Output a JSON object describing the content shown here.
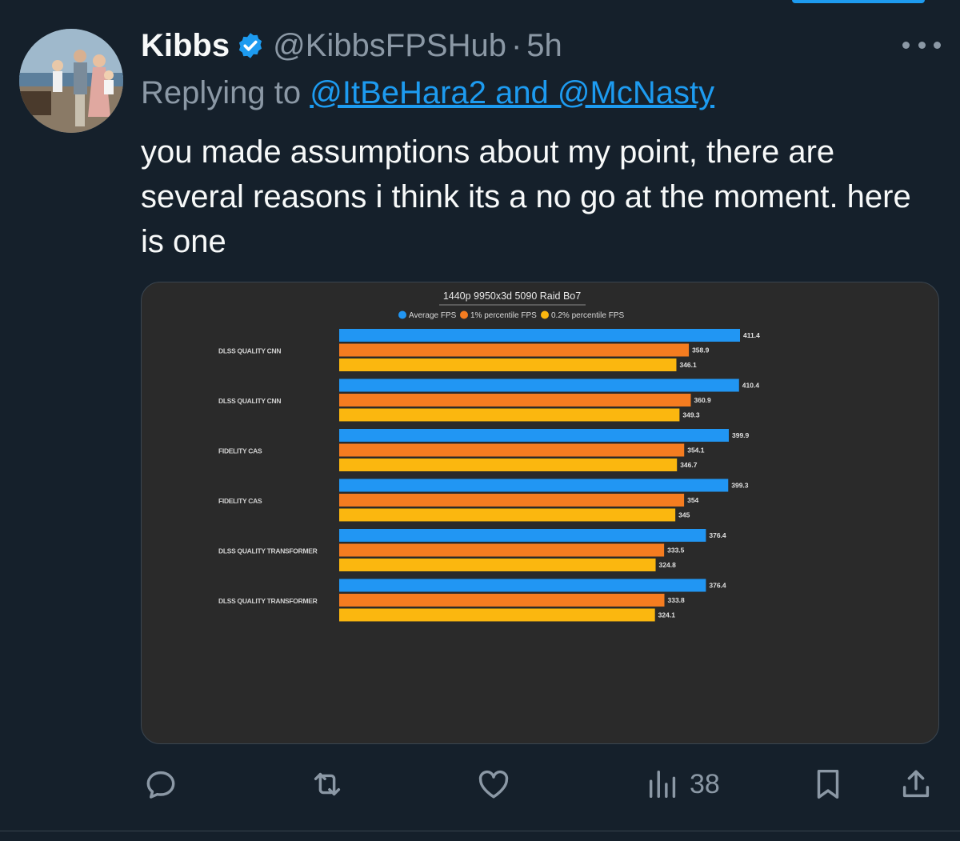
{
  "tweet": {
    "display_name": "Kibbs",
    "handle": "@KibbsFPSHub",
    "separator": "·",
    "time": "5h",
    "replying_prefix": "Replying to",
    "replying_to": "@ItBeHara2 and @McNasty",
    "text": "you made assumptions about my point, there are several reasons i think its a no go at the moment. here is one",
    "verified_icon": "verified-badge-icon",
    "more_icon": "more-options-icon"
  },
  "actions": {
    "reply_icon": "reply-icon",
    "retweet_icon": "retweet-icon",
    "like_icon": "like-icon",
    "views_icon": "views-icon",
    "views_count": "38",
    "bookmark_icon": "bookmark-icon",
    "share_icon": "share-icon"
  },
  "colors": {
    "background": "#15202b",
    "accent": "#1d9bf0",
    "muted_text": "#8b98a5",
    "chart_background": "#2a2a2a",
    "series_blue": "#2196f3",
    "series_orange": "#f57c20",
    "series_yellow": "#fbb70f"
  },
  "chart_data": {
    "type": "bar",
    "orientation": "horizontal",
    "title": "1440p 9950x3d 5090 Raid Bo7",
    "categories": [
      "DLSS QUALITY CNN",
      "DLSS QUALITY CNN",
      "FIDELITY CAS",
      "FIDELITY CAS",
      "DLSS QUALITY TRANSFORMER",
      "DLSS QUALITY TRANSFORMER"
    ],
    "series": [
      {
        "name": "Average FPS",
        "color": "#2196f3",
        "values": [
          411.4,
          410.4,
          399.9,
          399.3,
          376.4,
          376.4
        ],
        "labels": [
          "411.4",
          "410.4",
          "399.9",
          "399.3",
          "376.4",
          "376.4"
        ]
      },
      {
        "name": "1% percentile FPS",
        "color": "#f57c20",
        "values": [
          358.9,
          360.9,
          354.1,
          354,
          333.5,
          333.8
        ],
        "labels": [
          "358.9",
          "360.9",
          "354.1",
          "354",
          "333.5",
          "333.8"
        ]
      },
      {
        "name": "0.2% percentile FPS",
        "color": "#fbb70f",
        "values": [
          346.1,
          349.3,
          346.7,
          345,
          324.8,
          324.1
        ],
        "labels": [
          "346.1",
          "349.3",
          "346.7",
          "345",
          "324.8",
          "324.1"
        ]
      }
    ],
    "xlim": [
      0,
      411.4
    ],
    "legend": "top",
    "grid": false,
    "data_labels": true
  }
}
